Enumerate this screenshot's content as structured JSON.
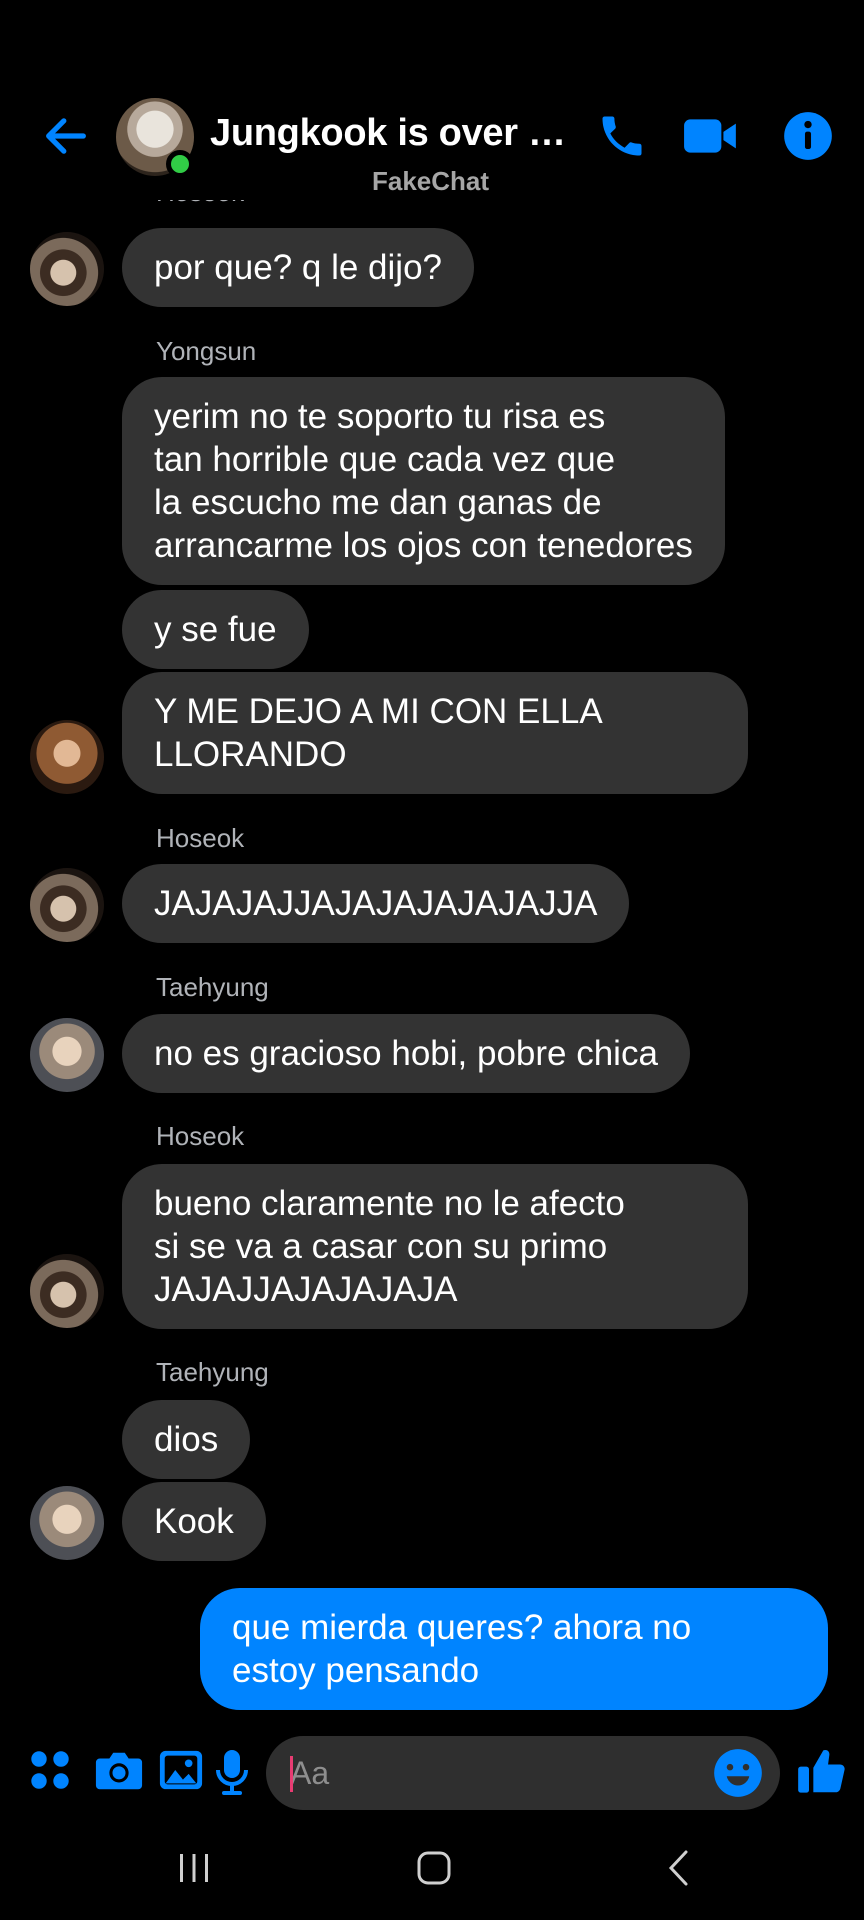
{
  "header": {
    "title": "Jungkook is over p...",
    "subtitle": "FakeChat",
    "icons": {
      "back": "arrow-left-icon",
      "phone": "phone-icon",
      "video": "video-camera-icon",
      "info": "info-icon"
    },
    "accent_color": "#0084ff",
    "online_color": "#31cc46"
  },
  "messages": {
    "cut_sender": "Hoseok",
    "m1": {
      "text": "por que? q le dijo?"
    },
    "s2": "Yongsun",
    "m2": {
      "text": "yerim no te soporto tu risa es\ntan horrible que cada vez que\nla escucho me dan ganas de\narrancarme los ojos con tenedores"
    },
    "m3": {
      "text": "y se fue"
    },
    "m4": {
      "text": "Y ME DEJO A MI CON ELLA\nLLORANDO"
    },
    "s5": "Hoseok",
    "m5": {
      "text": "JAJAJAJJAJAJAJAJAJAJJA"
    },
    "s6": "Taehyung",
    "m6": {
      "text": "no es gracioso hobi, pobre chica"
    },
    "s7": "Hoseok",
    "m7": {
      "text": "bueno claramente no le afecto\nsi se va a casar con su primo\nJAJAJJAJAJAJAJA"
    },
    "s8": "Taehyung",
    "m8": {
      "text": "dios"
    },
    "m9": {
      "text": "Kook"
    },
    "m10": {
      "text": "que mierda queres? ahora no\nestoy pensando"
    }
  },
  "composer": {
    "placeholder": "Aa",
    "value": "",
    "icons": [
      "apps-icon",
      "camera-icon",
      "gallery-icon",
      "microphone-icon",
      "emoji-icon",
      "thumbs-up-icon"
    ]
  },
  "navbar": {
    "icons": [
      "recent-apps-icon",
      "home-icon",
      "back-icon"
    ]
  },
  "colors": {
    "bubble_other": "#333333",
    "bubble_mine": "#0084ff",
    "background": "#000000"
  }
}
